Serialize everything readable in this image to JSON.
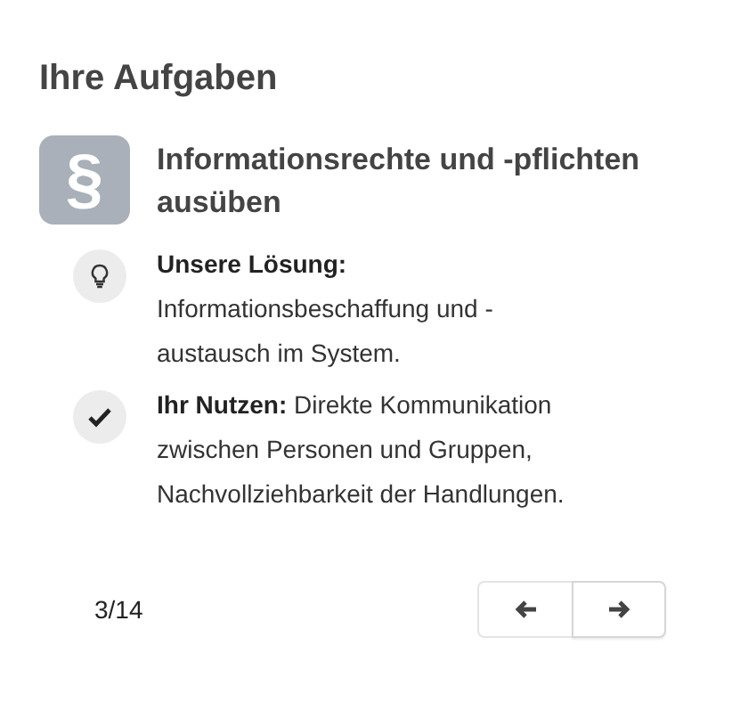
{
  "title": "Ihre Aufgaben",
  "task": {
    "heading": "Informationsrechte und -pflichten ausüben",
    "icon": "§"
  },
  "items": [
    {
      "kind": "idea",
      "text": "**Unsere Lösung:** Informationsbeschaffung und -austausch im System."
    },
    {
      "kind": "benefit",
      "text": "**Ihr Nutzen:** Direkte Kommunikation zwischen Personen und Gruppen, Nachvollziehbarkeit der Handlungen."
    }
  ],
  "pager": {
    "position": "3/14"
  }
}
